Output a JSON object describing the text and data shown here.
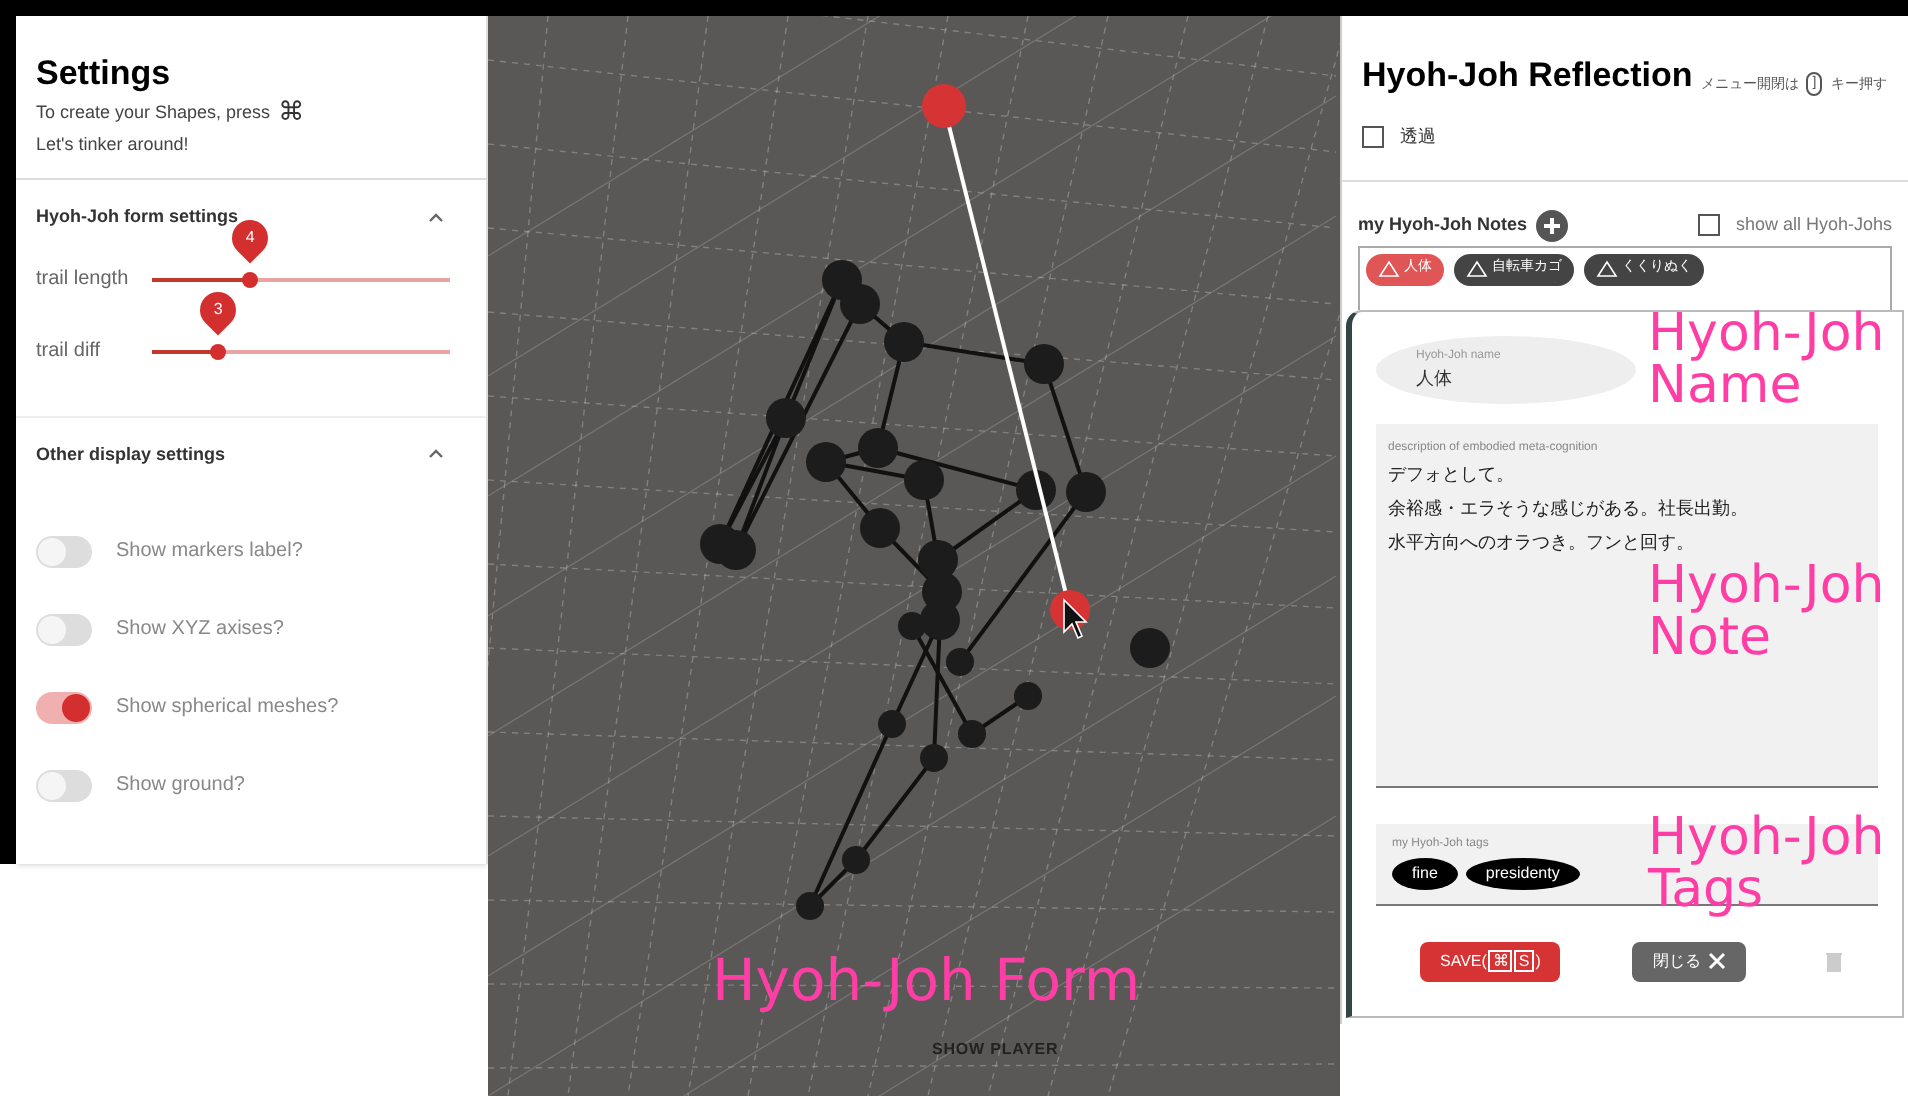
{
  "settings": {
    "title": "Settings",
    "hint": "To create your Shapes, press",
    "hint_key": "⌘",
    "subtitle": "Let's tinker around!",
    "sections": [
      {
        "title": "Hyoh-Joh form settings",
        "expanded": true,
        "sliders": [
          {
            "label": "trail length",
            "value": "4",
            "level": 0.33
          },
          {
            "label": "trail diff",
            "value": "3",
            "level": 0.22
          }
        ]
      },
      {
        "title": "Other display settings",
        "expanded": true,
        "toggles": [
          {
            "label": "Show markers label?",
            "on": false
          },
          {
            "label": "Show XYZ axises?",
            "on": false
          },
          {
            "label": "Show spherical meshes?",
            "on": true
          },
          {
            "label": "Show ground?",
            "on": false
          }
        ]
      }
    ]
  },
  "viewport": {
    "player_button": "SHOW PLAYER"
  },
  "reflection": {
    "title": "Hyoh-Joh Reflection",
    "menu_hint": "メニュー開閉は",
    "menu_key": "]",
    "menu_hint_end": "キー押す",
    "transparent": {
      "label": "透過",
      "checked": false
    },
    "notes_label": "my Hyoh-Joh Notes",
    "show_all": {
      "label": "show all Hyoh-Johs",
      "checked": false
    },
    "notes": [
      {
        "label": "人体",
        "selected": true
      },
      {
        "label": "自転車カゴ",
        "selected": false
      },
      {
        "label": "くくりぬく",
        "selected": false
      }
    ],
    "name_label": "Hyoh-Joh name",
    "name": "人体",
    "description_label": "description of embodied meta-cognition",
    "description": [
      "デフォとして。",
      "余裕感・エラそうな感じがある。社長出勤。",
      "水平方向へのオラつき。フンと回す。"
    ],
    "tags_label": "my Hyoh-Joh tags",
    "tags": [
      "fine",
      "presidenty"
    ],
    "save": {
      "label": "SAVE(",
      "key1": "⌘",
      "key2": "S",
      "end": ")"
    },
    "close": "閉じる"
  },
  "annotations": [
    "Hyoh-Joh Form",
    "Hyoh-Joh Name",
    "Hyoh-Joh Note",
    "Hyoh-Joh Tags"
  ]
}
